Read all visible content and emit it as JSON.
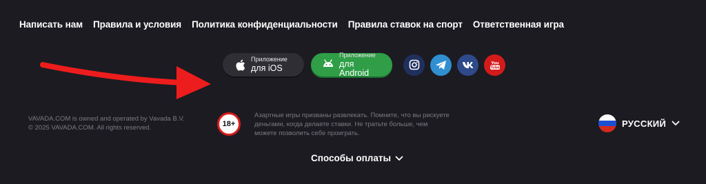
{
  "nav": {
    "items": [
      {
        "label": "Написать нам"
      },
      {
        "label": "Правила и условия"
      },
      {
        "label": "Политика конфиденциальности"
      },
      {
        "label": "Правила ставок на спорт"
      },
      {
        "label": "Ответственная игра"
      }
    ]
  },
  "apps": {
    "ios": {
      "small": "Приложение",
      "big": "для iOS",
      "icon": "apple-icon"
    },
    "android": {
      "small": "Приложение",
      "big": "для Android",
      "icon": "android-icon"
    }
  },
  "socials": [
    {
      "name": "instagram-icon",
      "color": "#20305e"
    },
    {
      "name": "telegram-icon",
      "color": "#2f8fd0"
    },
    {
      "name": "vk-icon",
      "color": "#2e4a8a"
    },
    {
      "name": "youtube-icon",
      "color": "#d31b1b"
    }
  ],
  "footer": {
    "company_line1": "VAVADA.COM is owned and operated by Vavada B.V.",
    "company_line2": "© 2025 VAVADA.COM. All rights reserved.",
    "age_badge": "18+",
    "warning": "Азартные игры призваны развлекать. Помните, что вы рискуете деньгами, когда делаете ставки. Не тратьте больше, чем можете позволить себе проиграть."
  },
  "language": {
    "label": "РУССКИЙ",
    "flag_colors": [
      "#ffffff",
      "#1f4fd1",
      "#d52b1e"
    ]
  },
  "payments": {
    "label": "Способы оплаты"
  },
  "annotation": {
    "color": "#ee1d1d"
  }
}
